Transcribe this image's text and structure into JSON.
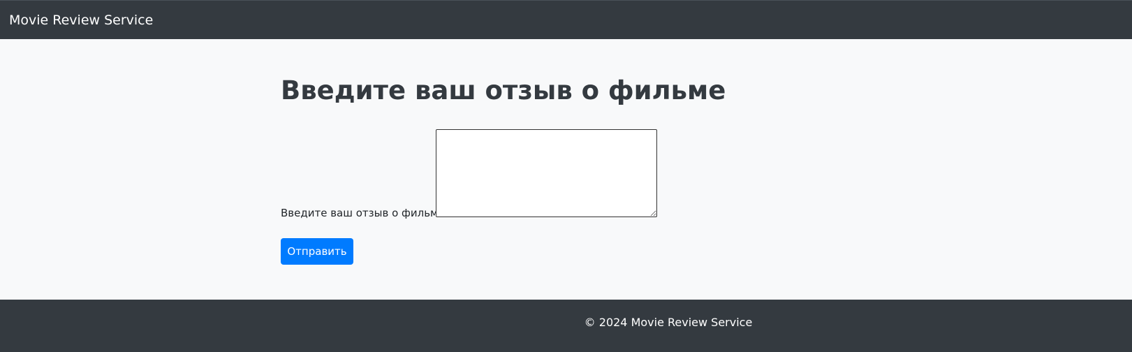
{
  "navbar": {
    "brand": "Movie Review Service"
  },
  "main": {
    "title": "Введите ваш отзыв о фильме",
    "review_label": "Введите ваш отзыв о фильме:",
    "review_value": "",
    "submit_label": "Отправить"
  },
  "footer": {
    "text": "© 2024 Movie Review Service"
  },
  "colors": {
    "navbar_bg": "#343a40",
    "page_bg": "#f8f9fa",
    "primary_button": "#007bff",
    "title_text": "#343a40"
  }
}
